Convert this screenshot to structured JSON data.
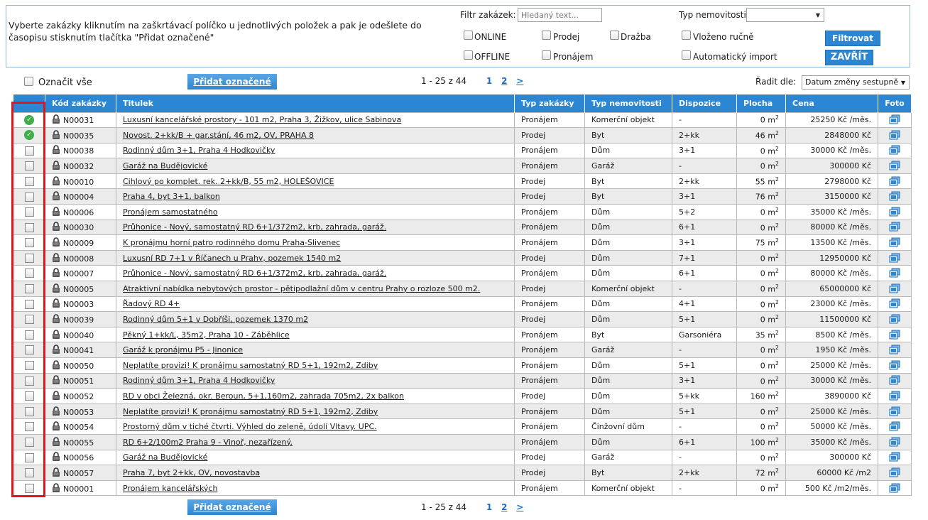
{
  "instructions": "Vyberte zakázky kliknutím na zaškrtávací políčko u jednotlivých položek a pak je odešlete do časopisu stisknutím tlačítka \"Přidat označené\"",
  "filter": {
    "label": "Filtr zakázek:",
    "placeholder": "Hledaný text...",
    "type_label": "Typ nemovitosti",
    "checkboxes": {
      "online": "ONLINE",
      "offline": "OFFLINE",
      "prodej": "Prodej",
      "pronajem": "Pronájem",
      "drazba": "Dražba",
      "vlozeno": "Vloženo ručně",
      "import": "Automatický import"
    },
    "filter_button": "Filtrovat",
    "close_button": "ZAVŘÍT"
  },
  "toolbar": {
    "select_all": "Označit vše",
    "add_button": "Přidat označené",
    "range": "1 - 25 z 44",
    "page1": "1",
    "page2": "2",
    "next": ">",
    "sort_label": "Řadit dle:",
    "sort_value": "Datum změny sestupně"
  },
  "columns": [
    "Kód zakázky",
    "Titulek",
    "Typ zakázky",
    "Typ nemovitosti",
    "Dispozice",
    "Plocha",
    "Cena",
    "Foto"
  ],
  "rows": [
    {
      "checked": true,
      "code": "N00031",
      "title": "Luxusní kancelářské prostory - 101 m2, Praha 3, Žižkov, ulice Sabinova",
      "type": "Pronájem",
      "prop": "Komerční objekt",
      "disp": "-",
      "area": "0",
      "price": "25250 Kč  /měs."
    },
    {
      "checked": true,
      "code": "N00035",
      "title": "Novost. 2+kk/B + gar.stání, 46 m2, OV, PRAHA 8",
      "type": "Prodej",
      "prop": "Byt",
      "disp": "2+kk",
      "area": "46",
      "price": "2848000 Kč"
    },
    {
      "checked": false,
      "code": "N00038",
      "title": "Rodinný dům 3+1, Praha 4 Hodkovičky",
      "type": "Pronájem",
      "prop": "Dům",
      "disp": "3+1",
      "area": "0",
      "price": "30000 Kč  /měs."
    },
    {
      "checked": false,
      "code": "N00032",
      "title": "Garáž na Budějovické",
      "type": "Pronájem",
      "prop": "Garáž",
      "disp": "-",
      "area": "0",
      "price": "300000 Kč"
    },
    {
      "checked": false,
      "code": "N00010",
      "title": "Cihlový po komplet. rek. 2+kk/B, 55 m2, HOLEŠOVICE",
      "type": "Prodej",
      "prop": "Byt",
      "disp": "2+kk",
      "area": "55",
      "price": "2798000 Kč"
    },
    {
      "checked": false,
      "code": "N00004",
      "title": "Praha 4, byt 3+1, balkon",
      "type": "Prodej",
      "prop": "Byt",
      "disp": "3+1",
      "area": "76",
      "price": "3150000 Kč"
    },
    {
      "checked": false,
      "code": "N00006",
      "title": "Pronájem samostatného",
      "type": "Pronájem",
      "prop": "Dům",
      "disp": "5+2",
      "area": "0",
      "price": "35000 Kč  /měs."
    },
    {
      "checked": false,
      "code": "N00030",
      "title": "Průhonice - Nový, samostatný RD 6+1/372m2, krb, zahrada, garáž.",
      "type": "Pronájem",
      "prop": "Dům",
      "disp": "6+1",
      "area": "0",
      "price": "80000 Kč  /měs."
    },
    {
      "checked": false,
      "code": "N00009",
      "title": "K pronájmu horní patro rodinného domu Praha-Slivenec",
      "type": "Pronájem",
      "prop": "Dům",
      "disp": "3+1",
      "area": "75",
      "price": "13500 Kč  /měs."
    },
    {
      "checked": false,
      "code": "N00008",
      "title": "Luxusní RD 7+1 v Říčanech u Prahy, pozemek 1540 m2",
      "type": "Prodej",
      "prop": "Dům",
      "disp": "7+1",
      "area": "0",
      "price": "12950000 Kč"
    },
    {
      "checked": false,
      "code": "N00007",
      "title": "Průhonice - Nový, samostatný RD 6+1/372m2, krb, zahrada, garáž.",
      "type": "Pronájem",
      "prop": "Dům",
      "disp": "6+1",
      "area": "0",
      "price": "80000 Kč  /měs."
    },
    {
      "checked": false,
      "code": "N00005",
      "title": "Atraktivní nabídka nebytových prostor - pětipodlažní dům v centru Prahy o rozloze 500 m2.",
      "type": "Prodej",
      "prop": "Komerční objekt",
      "disp": "-",
      "area": "0",
      "price": "65000000 Kč"
    },
    {
      "checked": false,
      "code": "N00003",
      "title": "Řadový RD 4+",
      "type": "Pronájem",
      "prop": "Dům",
      "disp": "4+1",
      "area": "0",
      "price": "23000 Kč  /měs."
    },
    {
      "checked": false,
      "code": "N00039",
      "title": "Rodinný dům 5+1 v Dobříši, pozemek 1370 m2",
      "type": "Prodej",
      "prop": "Dům",
      "disp": "5+1",
      "area": "0",
      "price": "11500000 Kč"
    },
    {
      "checked": false,
      "code": "N00040",
      "title": "Pěkný 1+kk/L, 35m2, Praha 10 - Záběhlice",
      "type": "Pronájem",
      "prop": "Byt",
      "disp": "Garsoniéra",
      "area": "35",
      "price": "8500 Kč  /měs."
    },
    {
      "checked": false,
      "code": "N00041",
      "title": "Garáž k pronájmu P5 - Jinonice",
      "type": "Pronájem",
      "prop": "Garáž",
      "disp": "-",
      "area": "0",
      "price": "1950 Kč  /měs."
    },
    {
      "checked": false,
      "code": "N00050",
      "title": "Neplatíte provizi! K pronájmu samostatný RD 5+1, 192m2, Zdiby",
      "type": "Pronájem",
      "prop": "Dům",
      "disp": "5+1",
      "area": "0",
      "price": "25000 Kč  /měs."
    },
    {
      "checked": false,
      "code": "N00051",
      "title": "Rodinný dům 3+1, Praha 4 Hodkovičky",
      "type": "Pronájem",
      "prop": "Dům",
      "disp": "3+1",
      "area": "0",
      "price": "30000 Kč  /měs."
    },
    {
      "checked": false,
      "code": "N00052",
      "title": "RD v obci Železná, okr. Beroun, 5+1,160m2, zahrada 705m2, 2x balkon",
      "type": "Prodej",
      "prop": "Dům",
      "disp": "5+kk",
      "area": "160",
      "price": "3890000 Kč"
    },
    {
      "checked": false,
      "code": "N00053",
      "title": "Neplatíte provizi! K pronájmu samostatný RD 5+1, 192m2, Zdiby",
      "type": "Pronájem",
      "prop": "Dům",
      "disp": "5+1",
      "area": "0",
      "price": "25000 Kč  /měs."
    },
    {
      "checked": false,
      "code": "N00054",
      "title": "Prostorný dům v tiché čtvrti. Výhled do zeleně, údolí Vltavy. UPC.",
      "type": "Pronájem",
      "prop": "Činžovní dům",
      "disp": "-",
      "area": "0",
      "price": "50000 Kč  /měs."
    },
    {
      "checked": false,
      "code": "N00055",
      "title": "RD 6+2/100m2 Praha 9 - Vinoř, nezařízený.",
      "type": "Pronájem",
      "prop": "Dům",
      "disp": "6+1",
      "area": "100",
      "price": "35000 Kč  /měs."
    },
    {
      "checked": false,
      "code": "N00056",
      "title": "Garáž na Budějovické",
      "type": "Prodej",
      "prop": "Garáž",
      "disp": "-",
      "area": "0",
      "price": "300000 Kč"
    },
    {
      "checked": false,
      "code": "N00057",
      "title": "Praha 7, byt 2+kk, OV, novostavba",
      "type": "Prodej",
      "prop": "Byt",
      "disp": "2+kk",
      "area": "72",
      "price": "60000 Kč  /m2"
    },
    {
      "checked": false,
      "code": "N00001",
      "title": "Pronájem kancelářských",
      "type": "Pronájem",
      "prop": "Komerční objekt",
      "disp": "-",
      "area": "0",
      "price": "500 Kč  /m2/měs."
    }
  ],
  "area_unit": "m",
  "area_exp": "2",
  "colors": {
    "header": "#2b87d3",
    "alt_row": "#ebebeb",
    "highlight": "#e0141b",
    "ok": "#3fae48"
  }
}
